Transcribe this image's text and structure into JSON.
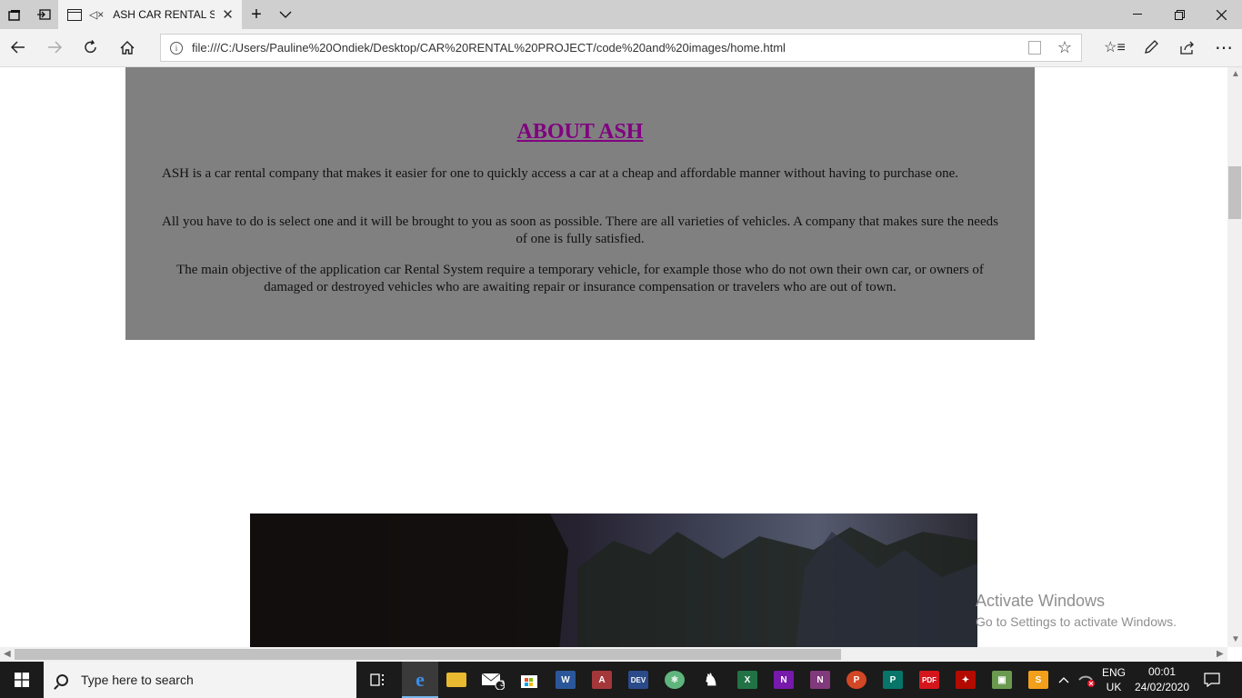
{
  "browser": {
    "tab_title": "ASH CAR RENTAL S",
    "url": "file:///C:/Users/Pauline%20Ondiek/Desktop/CAR%20RENTAL%20PROJECT/code%20and%20images/home.html",
    "icons": [
      "tab-manager-icon",
      "set-aside-tabs-icon",
      "page-icon",
      "mute-icon",
      "close-tab-icon",
      "new-tab-icon",
      "tab-list-icon",
      "minimize-icon",
      "restore-icon",
      "close-window-icon",
      "back-icon",
      "forward-icon",
      "refresh-icon",
      "home-icon",
      "info-icon",
      "reading-view-icon",
      "favorite-star-icon",
      "favorites-hub-icon",
      "pen-icon",
      "share-icon",
      "more-icon"
    ]
  },
  "page": {
    "about_heading": "ABOUT ASH",
    "paragraphs": [
      "ASH is a car rental company that makes it easier for one to quickly access a car at a cheap and affordable manner without having to purchase one.",
      "All you have to do is select one and it will be brought to you as soon as possible. There are all varieties of vehicles. A company that makes sure the needs of one is fully satisfied.",
      "The main objective of the application car Rental System require a temporary vehicle, for example those who do not own their own car, or owners of damaged or destroyed vehicles who are awaiting repair or insurance compensation or travelers who are out of town."
    ],
    "about_bg_color": "#808080",
    "heading_color": "#800080"
  },
  "watermark": {
    "line1": "Activate Windows",
    "line2": "Go to Settings to activate Windows."
  },
  "taskbar": {
    "search_placeholder": "Type here to search",
    "mail_badge": "3",
    "apps": [
      "task-view",
      "edge",
      "file-explorer",
      "mail",
      "store",
      "word",
      "access",
      "dev-cpp",
      "atom",
      "inkscape",
      "excel",
      "onenote",
      "onenote-2016",
      "powerpoint",
      "publisher",
      "pdf-reader",
      "acrobat",
      "android-studio",
      "sublime-text"
    ],
    "lang_top": "ENG",
    "lang_bottom": "UK",
    "time": "00:01",
    "date": "24/02/2020"
  }
}
